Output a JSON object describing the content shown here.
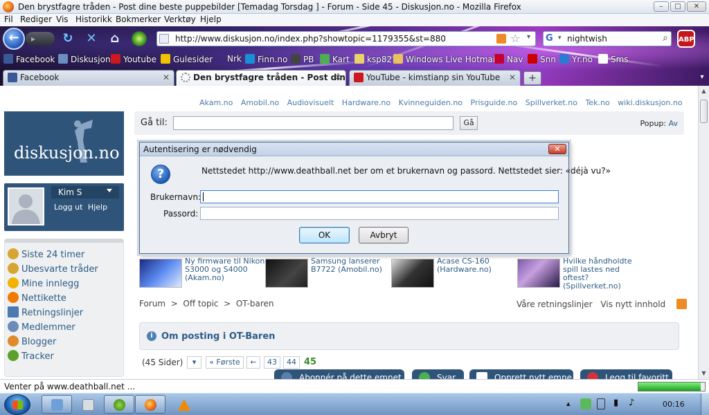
{
  "window": {
    "title": "Den brystfagre tråden - Post dine beste puppebilder [Temadag Torsdag ] - Forum - Side 45 - Diskusjon.no - Mozilla Firefox",
    "min": "–",
    "max": "□",
    "close": "✕"
  },
  "menu": [
    "Fil",
    "Rediger",
    "Vis",
    "Historikk",
    "Bokmerker",
    "Verktøy",
    "Hjelp"
  ],
  "nav": {
    "back": "←",
    "forward": "▸",
    "reload": "↻",
    "stop": "✕",
    "home": "⌂",
    "url": "http://www.diskusjon.no/index.php?showtopic=1179355&st=880",
    "search_query": "nightwish",
    "search_engine": "G",
    "adblock": "ABP"
  },
  "bookmarks": [
    {
      "label": "Facebook",
      "color": "#3b5998"
    },
    {
      "label": "Diskusjon",
      "color": "#6a8fc0"
    },
    {
      "label": "Youtube",
      "color": "#cc181e"
    },
    {
      "label": "Gulesider",
      "color": "#f2c200"
    },
    {
      "label": "Nrk",
      "color": "#000000"
    },
    {
      "label": "Finn.no",
      "color": "#1a8fd6"
    },
    {
      "label": "PB",
      "color": "#444444"
    },
    {
      "label": "Kart",
      "color": "#4caf50"
    },
    {
      "label": "ksp82",
      "color": "#e8d36a"
    },
    {
      "label": "Windows Live Hotmail",
      "color": "#e8c25a"
    },
    {
      "label": "Nav",
      "color": "#c3002f"
    },
    {
      "label": "Snn",
      "color": "#cc0000"
    },
    {
      "label": "Yr.no",
      "color": "#2b7bd0"
    },
    {
      "label": "Sms",
      "color": "#ffffff"
    }
  ],
  "tabs": [
    {
      "label": "Facebook",
      "color": "#3b5998",
      "close": "✕"
    },
    {
      "label": "Den brystfagre tråden - Post dine...",
      "color": "#999999",
      "close": "✕"
    },
    {
      "label": "YouTube - kimstianp sin YouTube",
      "color": "#cc181e",
      "close": "✕"
    }
  ],
  "newtab": "+",
  "tab_overflow": "▾",
  "site": {
    "top_links": [
      "Akam.no",
      "Amobil.no",
      "Audiovisuelt",
      "Hardware.no",
      "Kvinneguiden.no",
      "Prisguide.no",
      "Spillverket.no",
      "Tek.no",
      "wiki.diskusjon.no"
    ],
    "logo": "diskusjon.no",
    "user": {
      "name": "Kim S",
      "logout": "Logg ut",
      "help": "Hjelp"
    },
    "sidenav": [
      {
        "label": "Siste 24 timer",
        "color": "#d7a531"
      },
      {
        "label": "Ubesvarte tråder",
        "color": "#d7a531"
      },
      {
        "label": "Mine innlegg",
        "color": "#f0b400"
      },
      {
        "label": "Nettikette",
        "color": "#f07b00"
      },
      {
        "label": "Retningslinjer",
        "color": "#4a7ab0"
      },
      {
        "label": "Medlemmer",
        "color": "#6b8cb8"
      },
      {
        "label": "Blogger",
        "color": "#e08a2a"
      },
      {
        "label": "Tracker",
        "color": "#5aa02a"
      }
    ],
    "goto": {
      "label": "Gå til:",
      "button": "Gå",
      "popup_label": "Popup:",
      "popup_value": "Av"
    },
    "ads": [
      {
        "text": [
          "Ny firmware til Nikon",
          "S3000 og S4000",
          "(Akam.no)"
        ],
        "color": "#3a5fd0"
      },
      {
        "text": [
          "Samsung lanserer",
          "B7722 (Amobil.no)"
        ],
        "color": "#222222"
      },
      {
        "text": [
          "Acase CS-160",
          "(Hardware.no)"
        ],
        "color": "#333333"
      },
      {
        "text": [
          "Hvilke håndholdte",
          "spill lastes ned",
          "oftest?",
          "(Spillverket.no)"
        ],
        "color": "#6a4a8a"
      }
    ],
    "breadcrumb": {
      "items": [
        "Forum",
        "Off topic",
        "OT-baren"
      ],
      "sep": ">"
    },
    "breadcrumb_right": {
      "guidelines": "Våre retningslinjer",
      "new_content": "Vis nytt innhold"
    },
    "notice": {
      "icon": "i",
      "title": "Om posting i OT-Baren"
    },
    "pager": {
      "pages_label": "(45 Sider)",
      "dropdown": "▾",
      "first": "« Første",
      "prev": "←",
      "p1": "43",
      "p2": "44",
      "current": "45"
    },
    "post_buttons": [
      "Abonnér på dette emnet",
      "Svar",
      "Opprett nytt emne",
      "Legg til favoritt"
    ]
  },
  "dialog": {
    "title": "Autentisering er nødvendig",
    "close": "✕",
    "icon": "?",
    "message": "Nettstedet http://www.deathball.net ber om et brukernavn og passord. Nettstedet sier: «déjà vu?»",
    "username_label": "Brukernavn:",
    "password_label": "Passord:",
    "username_value": "",
    "password_value": "",
    "ok": "OK",
    "cancel": "Avbryt"
  },
  "status": {
    "text": "Venter på www.deathball.net ...",
    "progress": 0.94
  },
  "taskbar": {
    "clock": "00:16",
    "tray_arrow": "▴"
  }
}
